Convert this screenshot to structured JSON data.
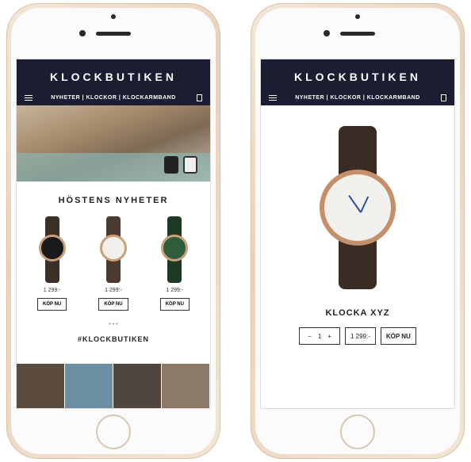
{
  "left": {
    "header": {
      "logo": "KLOCKBUTIKEN",
      "nav": "NYHETER | KLOCKOR | KLOCKARMBAND"
    },
    "section_title": "HÖSTENS NYHETER",
    "products": [
      {
        "price": "1 299:-",
        "button": "KÖP NU",
        "strap": "#3a2f29",
        "face": "#1a1a1a"
      },
      {
        "price": "1 299:-",
        "button": "KÖP NU",
        "strap": "#4a3a30",
        "face": "#f2f0ec"
      },
      {
        "price": "1 299:-",
        "button": "KÖP NU",
        "strap": "#1e3a27",
        "face": "#2f5d3c"
      }
    ],
    "pager": "• • •",
    "hashtag": "#KLOCKBUTIKEN",
    "insta_colors": [
      "#5b4b3e",
      "#6c8ea3",
      "#4f463f",
      "#8c7a68"
    ]
  },
  "right": {
    "header": {
      "logo": "KLOCKBUTIKEN",
      "nav": "NYHETER | KLOCKOR | KLOCKARMBAND"
    },
    "product_name": "KLOCKA XYZ",
    "qty": {
      "minus": "−",
      "value": "1",
      "plus": "+"
    },
    "price": "1 299:-",
    "button": "KÖP NU"
  }
}
